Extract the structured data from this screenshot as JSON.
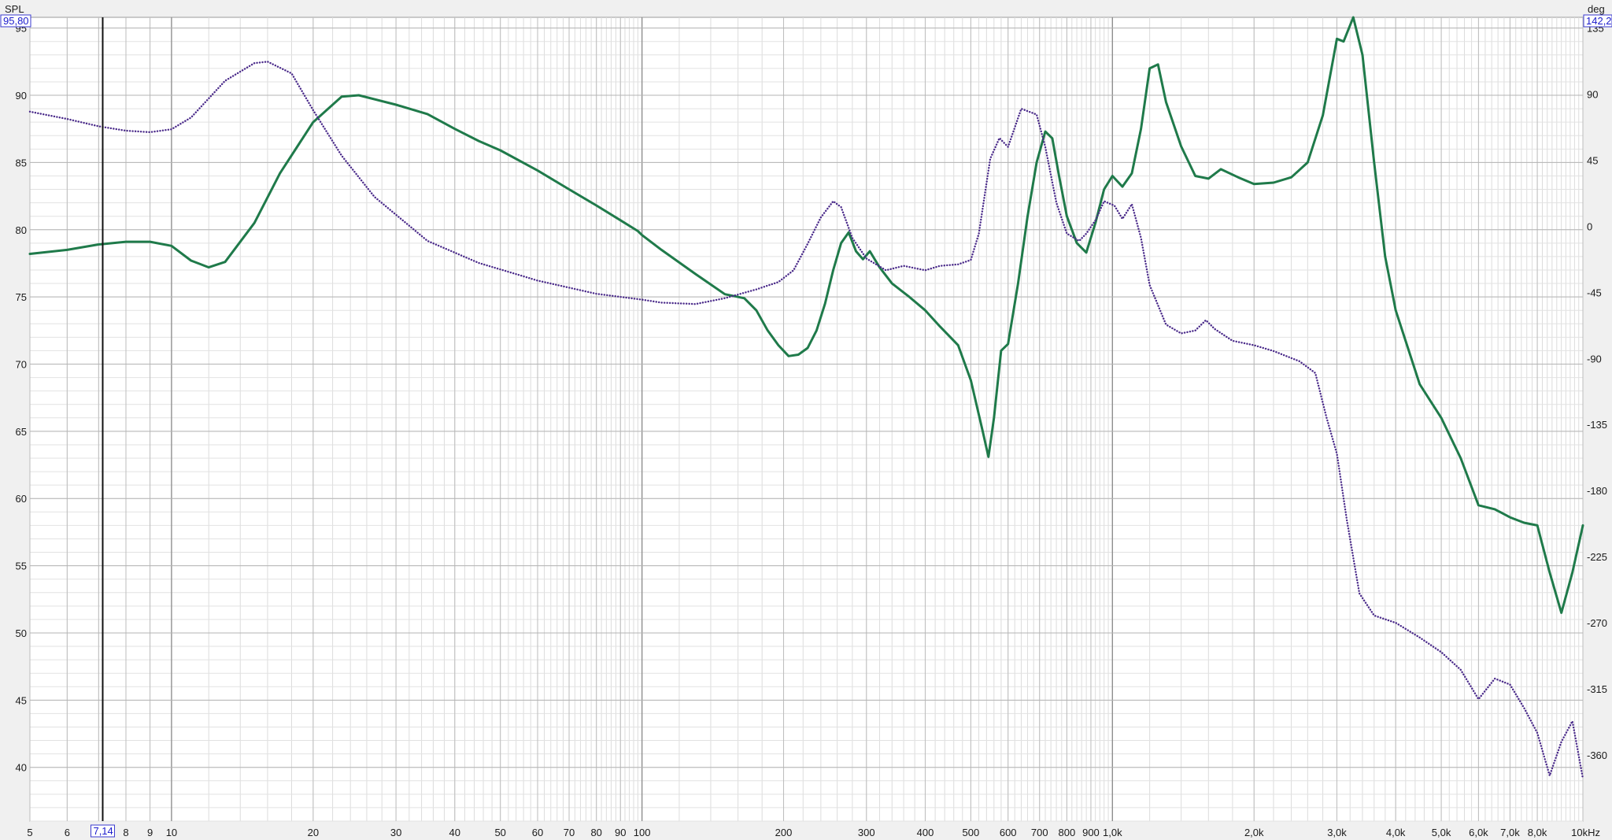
{
  "chart_data": {
    "type": "line",
    "title": "",
    "xlabel": "",
    "x_scale": "log",
    "xlim": [
      5,
      10000
    ],
    "ylabel_left": "SPL",
    "ylabel_right": "deg",
    "ylim_left": [
      36,
      95.8
    ],
    "ylim_right": [
      -405,
      142.2
    ],
    "x_tick_values": [
      5,
      6,
      7,
      8,
      9,
      10,
      20,
      30,
      40,
      50,
      60,
      70,
      80,
      90,
      100,
      200,
      300,
      400,
      500,
      600,
      700,
      800,
      900,
      1000,
      2000,
      3000,
      4000,
      5000,
      6000,
      7000,
      8000,
      10000
    ],
    "x_tick_labels": [
      "5",
      "6",
      "",
      "8",
      "9",
      "10",
      "20",
      "30",
      "40",
      "50",
      "60",
      "70",
      "80",
      "90",
      "100",
      "200",
      "300",
      "400",
      "500",
      "600",
      "700",
      "800",
      "900",
      "1,0k",
      "2,0k",
      "3,0k",
      "4,0k",
      "5,0k",
      "6,0k",
      "7,0k",
      "8,0k",
      "10kHz"
    ],
    "y_left_ticks": [
      95,
      90,
      85,
      80,
      75,
      70,
      65,
      60,
      55,
      50,
      45,
      40
    ],
    "y_right_ticks": [
      135,
      90,
      45,
      0,
      -45,
      -90,
      -135,
      -180,
      -225,
      -270,
      -315,
      -360
    ],
    "grid": true,
    "cursor": {
      "x_readout": "7,14",
      "x": 7.14,
      "y_left_readout": "95,80",
      "y_right_readout": "142,2"
    },
    "series": [
      {
        "axis": "left",
        "color": "#1f7a4a",
        "style": "solid",
        "points": [
          [
            5,
            78.2
          ],
          [
            6,
            78.5
          ],
          [
            7,
            78.9
          ],
          [
            8,
            79.1
          ],
          [
            9,
            79.1
          ],
          [
            10,
            78.8
          ],
          [
            11,
            77.7
          ],
          [
            12,
            77.2
          ],
          [
            13,
            77.6
          ],
          [
            15,
            80.5
          ],
          [
            17,
            84.2
          ],
          [
            20,
            88.0
          ],
          [
            23,
            89.9
          ],
          [
            25,
            90.0
          ],
          [
            30,
            89.3
          ],
          [
            35,
            88.6
          ],
          [
            40,
            87.5
          ],
          [
            45,
            86.6
          ],
          [
            50,
            85.9
          ],
          [
            60,
            84.4
          ],
          [
            70,
            83.0
          ],
          [
            80,
            81.8
          ],
          [
            90,
            80.7
          ],
          [
            98,
            79.9
          ],
          [
            100,
            79.6
          ],
          [
            110,
            78.5
          ],
          [
            130,
            76.7
          ],
          [
            150,
            75.2
          ],
          [
            165,
            74.9
          ],
          [
            175,
            74.0
          ],
          [
            185,
            72.5
          ],
          [
            195,
            71.4
          ],
          [
            205,
            70.6
          ],
          [
            215,
            70.7
          ],
          [
            225,
            71.2
          ],
          [
            235,
            72.5
          ],
          [
            245,
            74.5
          ],
          [
            255,
            77.0
          ],
          [
            265,
            79.0
          ],
          [
            275,
            79.8
          ],
          [
            285,
            78.4
          ],
          [
            295,
            77.8
          ],
          [
            305,
            78.4
          ],
          [
            320,
            77.2
          ],
          [
            340,
            76.0
          ],
          [
            370,
            75.0
          ],
          [
            400,
            74.0
          ],
          [
            430,
            72.8
          ],
          [
            470,
            71.4
          ],
          [
            500,
            68.8
          ],
          [
            530,
            65.0
          ],
          [
            545,
            63.1
          ],
          [
            560,
            66.0
          ],
          [
            580,
            71.0
          ],
          [
            600,
            71.5
          ],
          [
            630,
            76.0
          ],
          [
            660,
            81.0
          ],
          [
            690,
            85.0
          ],
          [
            720,
            87.3
          ],
          [
            745,
            86.8
          ],
          [
            770,
            84.0
          ],
          [
            800,
            81.0
          ],
          [
            840,
            79.0
          ],
          [
            880,
            78.3
          ],
          [
            920,
            80.5
          ],
          [
            960,
            83.0
          ],
          [
            1000,
            84.0
          ],
          [
            1050,
            83.2
          ],
          [
            1100,
            84.2
          ],
          [
            1150,
            87.5
          ],
          [
            1200,
            92.0
          ],
          [
            1250,
            92.3
          ],
          [
            1300,
            89.5
          ],
          [
            1400,
            86.2
          ],
          [
            1500,
            84.0
          ],
          [
            1600,
            83.8
          ],
          [
            1700,
            84.5
          ],
          [
            1850,
            83.9
          ],
          [
            2000,
            83.4
          ],
          [
            2200,
            83.5
          ],
          [
            2400,
            83.9
          ],
          [
            2600,
            85.0
          ],
          [
            2800,
            88.5
          ],
          [
            3000,
            94.2
          ],
          [
            3100,
            94.0
          ],
          [
            3250,
            95.8
          ],
          [
            3400,
            93.0
          ],
          [
            3600,
            85.0
          ],
          [
            3800,
            78.0
          ],
          [
            4000,
            74.0
          ],
          [
            4500,
            68.5
          ],
          [
            5000,
            66.0
          ],
          [
            5500,
            63.0
          ],
          [
            6000,
            59.5
          ],
          [
            6500,
            59.2
          ],
          [
            7000,
            58.6
          ],
          [
            7500,
            58.2
          ],
          [
            8000,
            58.0
          ],
          [
            8500,
            54.5
          ],
          [
            9000,
            51.5
          ],
          [
            9500,
            54.5
          ],
          [
            10000,
            58.0
          ]
        ]
      },
      {
        "axis": "right",
        "color": "#4a2a8a",
        "style": "dotted",
        "points": [
          [
            5,
            78
          ],
          [
            6,
            73
          ],
          [
            7,
            68
          ],
          [
            8,
            65
          ],
          [
            9,
            64
          ],
          [
            10,
            66
          ],
          [
            11,
            74
          ],
          [
            13,
            99
          ],
          [
            15,
            111
          ],
          [
            16,
            112
          ],
          [
            18,
            104
          ],
          [
            20,
            79
          ],
          [
            23,
            48
          ],
          [
            27,
            20
          ],
          [
            35,
            -10
          ],
          [
            45,
            -25
          ],
          [
            60,
            -37
          ],
          [
            80,
            -46
          ],
          [
            100,
            -50
          ],
          [
            110,
            -52
          ],
          [
            130,
            -53
          ],
          [
            150,
            -49
          ],
          [
            175,
            -43
          ],
          [
            195,
            -38
          ],
          [
            210,
            -30
          ],
          [
            225,
            -12
          ],
          [
            240,
            6
          ],
          [
            255,
            17
          ],
          [
            265,
            13
          ],
          [
            280,
            -8
          ],
          [
            300,
            -22
          ],
          [
            330,
            -30
          ],
          [
            360,
            -27
          ],
          [
            400,
            -30
          ],
          [
            430,
            -27
          ],
          [
            470,
            -26
          ],
          [
            500,
            -23
          ],
          [
            520,
            -5
          ],
          [
            550,
            46
          ],
          [
            575,
            60
          ],
          [
            600,
            54
          ],
          [
            640,
            80
          ],
          [
            690,
            76
          ],
          [
            720,
            54
          ],
          [
            760,
            16
          ],
          [
            800,
            -5
          ],
          [
            850,
            -10
          ],
          [
            880,
            -5
          ],
          [
            920,
            4
          ],
          [
            960,
            17
          ],
          [
            1010,
            14
          ],
          [
            1050,
            5
          ],
          [
            1100,
            15
          ],
          [
            1150,
            -8
          ],
          [
            1200,
            -40
          ],
          [
            1300,
            -67
          ],
          [
            1400,
            -73
          ],
          [
            1500,
            -71
          ],
          [
            1580,
            -64
          ],
          [
            1650,
            -70
          ],
          [
            1800,
            -78
          ],
          [
            2000,
            -81
          ],
          [
            2200,
            -85
          ],
          [
            2500,
            -92
          ],
          [
            2700,
            -100
          ],
          [
            2850,
            -130
          ],
          [
            3000,
            -155
          ],
          [
            3150,
            -200
          ],
          [
            3350,
            -250
          ],
          [
            3600,
            -265
          ],
          [
            4000,
            -270
          ],
          [
            4500,
            -280
          ],
          [
            5000,
            -290
          ],
          [
            5500,
            -302
          ],
          [
            6000,
            -322
          ],
          [
            6500,
            -308
          ],
          [
            7000,
            -312
          ],
          [
            7500,
            -328
          ],
          [
            8000,
            -345
          ],
          [
            8500,
            -374
          ],
          [
            9000,
            -351
          ],
          [
            9500,
            -337
          ],
          [
            10000,
            -376
          ]
        ]
      }
    ]
  }
}
